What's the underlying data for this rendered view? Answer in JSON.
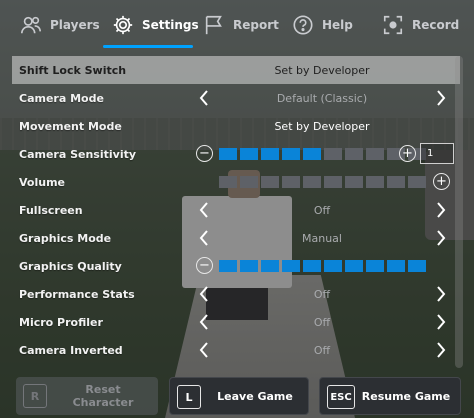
{
  "tabs": [
    {
      "label": "Players",
      "icon": "players-icon",
      "active": false
    },
    {
      "label": "Settings",
      "icon": "gear-icon",
      "active": true
    },
    {
      "label": "Report",
      "icon": "flag-icon",
      "active": false
    },
    {
      "label": "Help",
      "icon": "help-icon",
      "active": false
    },
    {
      "label": "Record",
      "icon": "record-icon",
      "active": false
    }
  ],
  "accent_color": "#00a2ff",
  "slider_on_color": "#0a84d8",
  "settings": {
    "shift_lock": {
      "label": "Shift Lock Switch",
      "value": "Set by Developer"
    },
    "camera_mode": {
      "label": "Camera Mode",
      "value": "Default (Classic)"
    },
    "movement_mode": {
      "label": "Movement Mode",
      "value": "Set by Developer"
    },
    "camera_sensitivity": {
      "label": "Camera Sensitivity",
      "level": 5,
      "max": 10,
      "value": "1"
    },
    "volume": {
      "label": "Volume",
      "level": 0,
      "max": 10
    },
    "fullscreen": {
      "label": "Fullscreen",
      "value": "Off"
    },
    "graphics_mode": {
      "label": "Graphics Mode",
      "value": "Manual"
    },
    "graphics_quality": {
      "label": "Graphics Quality",
      "level": 10,
      "max": 10
    },
    "performance_stats": {
      "label": "Performance Stats",
      "value": "Off"
    },
    "micro_profiler": {
      "label": "Micro Profiler",
      "value": "Off"
    },
    "camera_inverted": {
      "label": "Camera Inverted",
      "value": "Off"
    }
  },
  "buttons": {
    "reset": {
      "key": "R",
      "label": "Reset Character"
    },
    "leave": {
      "key": "L",
      "label": "Leave Game"
    },
    "resume": {
      "key": "ESC",
      "label": "Resume Game"
    }
  }
}
